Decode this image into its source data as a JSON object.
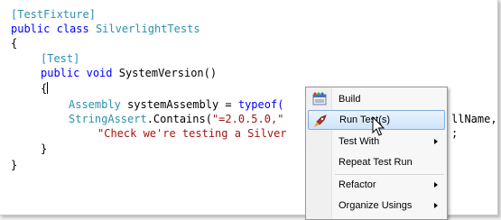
{
  "code": {
    "line1": {
      "attr": "[TestFixture]"
    },
    "line2": {
      "kw_public": "public",
      "kw_class": "class",
      "class_name": "SilverlightTests"
    },
    "line3": {
      "brace": "{"
    },
    "line4": {
      "attr": "[Test]"
    },
    "line5": {
      "kw_public": "public",
      "kw_void": "void",
      "method": "SystemVersion()"
    },
    "line6": {
      "brace": "{"
    },
    "line7": {
      "type": "Assembly",
      "decl": "systemAssembly = ",
      "kw_typeof": "typeof("
    },
    "line8": {
      "type": "StringAssert",
      "call": ".Contains(",
      "str": "\"=2.0.5.0,\"",
      "tail": "llName,"
    },
    "line9": {
      "str": "\"Check we're testing a Silver",
      "tail": ";"
    },
    "line10": {
      "brace": "}"
    },
    "line11": {
      "brace": "}"
    }
  },
  "context_menu": {
    "items": [
      {
        "label": "Build",
        "icon": "build-icon"
      },
      {
        "label": "Run Test(s)",
        "icon": "rocket-icon"
      },
      {
        "label": "Test With"
      },
      {
        "label": "Repeat Test Run"
      },
      {
        "label": "Refactor"
      },
      {
        "label": "Organize Usings"
      }
    ]
  },
  "colors": {
    "keyword": "#0000ff",
    "type": "#2b91af",
    "string": "#a31515",
    "menu_highlight": "#cfe4fa"
  }
}
